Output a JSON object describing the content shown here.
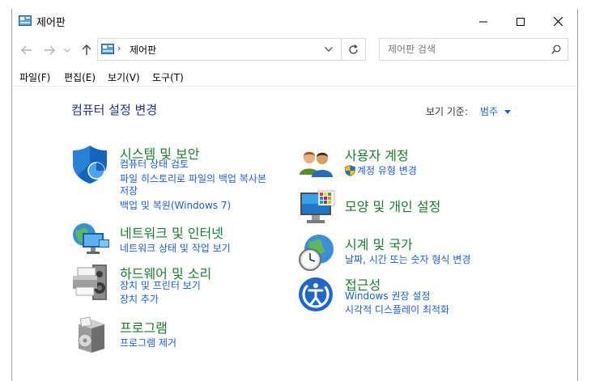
{
  "window": {
    "title": "제어판"
  },
  "address": {
    "crumb": "제어판"
  },
  "search": {
    "placeholder": "제어판 검색"
  },
  "menu": [
    {
      "label": "파일(F)"
    },
    {
      "label": "편집(E)"
    },
    {
      "label": "보기(V)"
    },
    {
      "label": "도구(T)"
    }
  ],
  "content": {
    "heading": "컴퓨터 설정 변경",
    "view_by_label": "보기 기준:",
    "view_by_value": "범주"
  },
  "categories": {
    "system": {
      "title": "시스템 및 보안",
      "links": [
        "컴퓨터 상태 검토",
        "파일 히스토리로 파일의 백업 복사본",
        "저장",
        "백업 및 복원(Windows 7)"
      ]
    },
    "network": {
      "title": "네트워크 및 인터넷",
      "links": [
        "네트워크 상태 및 작업 보기"
      ]
    },
    "hardware": {
      "title": "하드웨어 및 소리",
      "links": [
        "장치 및 프린터 보기",
        "장치 추가"
      ]
    },
    "programs": {
      "title": "프로그램",
      "links": [
        "프로그램 제거"
      ]
    },
    "users": {
      "title": "사용자 계정",
      "links": [
        "계정 유형 변경"
      ]
    },
    "appearance": {
      "title": "모양 및 개인 설정",
      "links": []
    },
    "clock": {
      "title": "시계 및 국가",
      "links": [
        "날짜, 시간 또는 숫자 형식 변경"
      ]
    },
    "ease": {
      "title": "접근성",
      "links": [
        "Windows 권장 설정",
        "시각적 디스플레이 최적화"
      ]
    }
  },
  "icons": {
    "title": "control-panel-icon",
    "system": "shield-icon",
    "network": "globe-monitors-icon",
    "hardware": "printer-speaker-icon",
    "programs": "program-box-icon",
    "users": "users-icon",
    "appearance": "monitor-palette-icon",
    "clock": "clock-globe-icon",
    "ease": "ease-of-access-icon"
  },
  "colors": {
    "link": "#1e5ec8",
    "category": "#1a7b2d",
    "heading": "#1e3287"
  }
}
